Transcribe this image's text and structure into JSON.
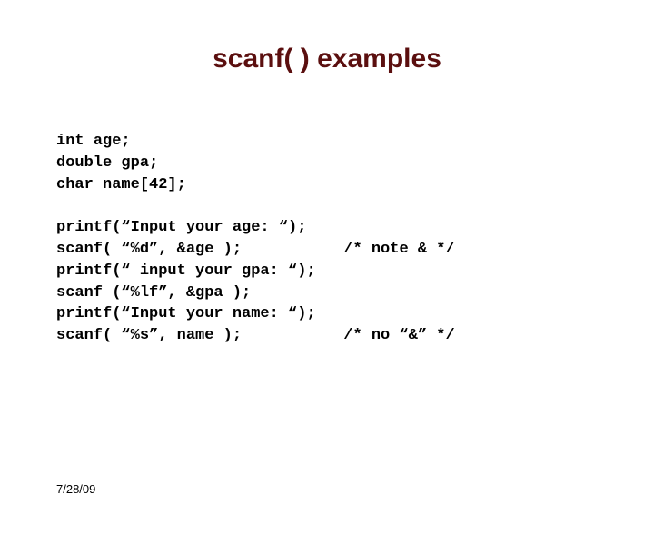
{
  "title": "scanf( ) examples",
  "code": "int age;\ndouble gpa;\nchar name[42];\n\nprintf(“Input your age: “);\nscanf( “%d”, &age );           /* note & */\nprintf(“ input your gpa: “);\nscanf (“%lf”, &gpa );\nprintf(“Input your name: “);\nscanf( “%s”, name );           /* no “&” */",
  "footer_date": "7/28/09"
}
